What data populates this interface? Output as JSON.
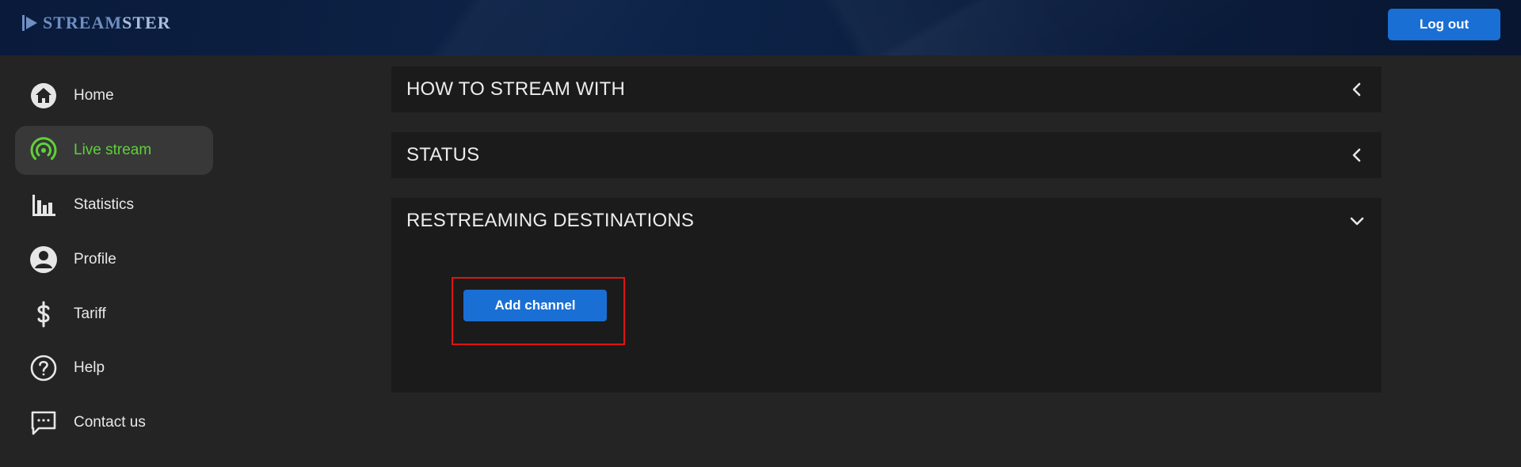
{
  "header": {
    "logo_prefix": "STREAM",
    "logo_suffix": "STER",
    "logout_label": "Log out"
  },
  "sidebar": {
    "items": [
      {
        "label": "Home",
        "icon": "home-icon",
        "active": false
      },
      {
        "label": "Live stream",
        "icon": "broadcast-icon",
        "active": true
      },
      {
        "label": "Statistics",
        "icon": "bar-chart-icon",
        "active": false
      },
      {
        "label": "Profile",
        "icon": "user-circle-icon",
        "active": false
      },
      {
        "label": "Tariff",
        "icon": "dollar-icon",
        "active": false
      },
      {
        "label": "Help",
        "icon": "help-circle-icon",
        "active": false
      },
      {
        "label": "Contact us",
        "icon": "chat-icon",
        "active": false
      }
    ]
  },
  "main": {
    "panels": [
      {
        "title": "HOW TO STREAM WITH",
        "state": "collapsed"
      },
      {
        "title": "STATUS",
        "state": "collapsed"
      },
      {
        "title": "RESTREAMING DESTINATIONS",
        "state": "expanded"
      }
    ],
    "add_channel_label": "Add channel"
  },
  "colors": {
    "accent_blue": "#1a6fd4",
    "active_green": "#5fd13a",
    "highlight_red": "#e01414",
    "panel_bg": "#1b1b1b",
    "page_bg": "#242424"
  }
}
